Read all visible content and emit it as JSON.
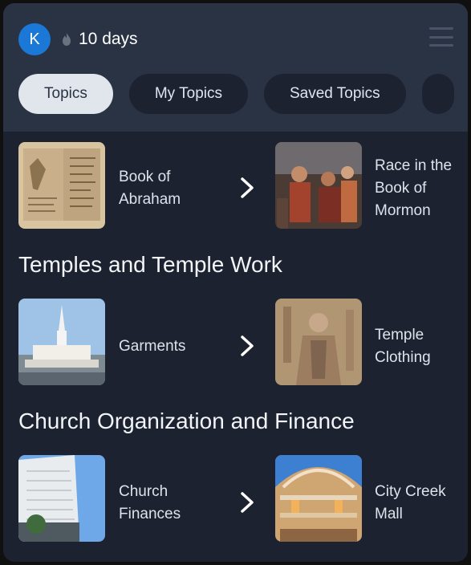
{
  "header": {
    "avatar_initial": "K",
    "streak_text": "10 days",
    "icons": {
      "streak": "flame-icon",
      "menu": "menu-icon"
    }
  },
  "tabs": [
    {
      "label": "Topics",
      "active": true
    },
    {
      "label": "My Topics",
      "active": false
    },
    {
      "label": "Saved Topics",
      "active": false
    }
  ],
  "rows": [
    {
      "from": "Book of Abraham",
      "to": "Race in the Book of Mormon"
    },
    {
      "section": "Temples and Temple Work",
      "from": "Garments",
      "to": "Temple Clothing"
    },
    {
      "section": "Church Organization and Finance",
      "from": "Church Finances",
      "to": "City Creek Mall"
    }
  ],
  "colors": {
    "background": "#1c2230",
    "header": "#2a3344",
    "accent": "#1b78d6",
    "active_tab": "#e1e6ed"
  }
}
